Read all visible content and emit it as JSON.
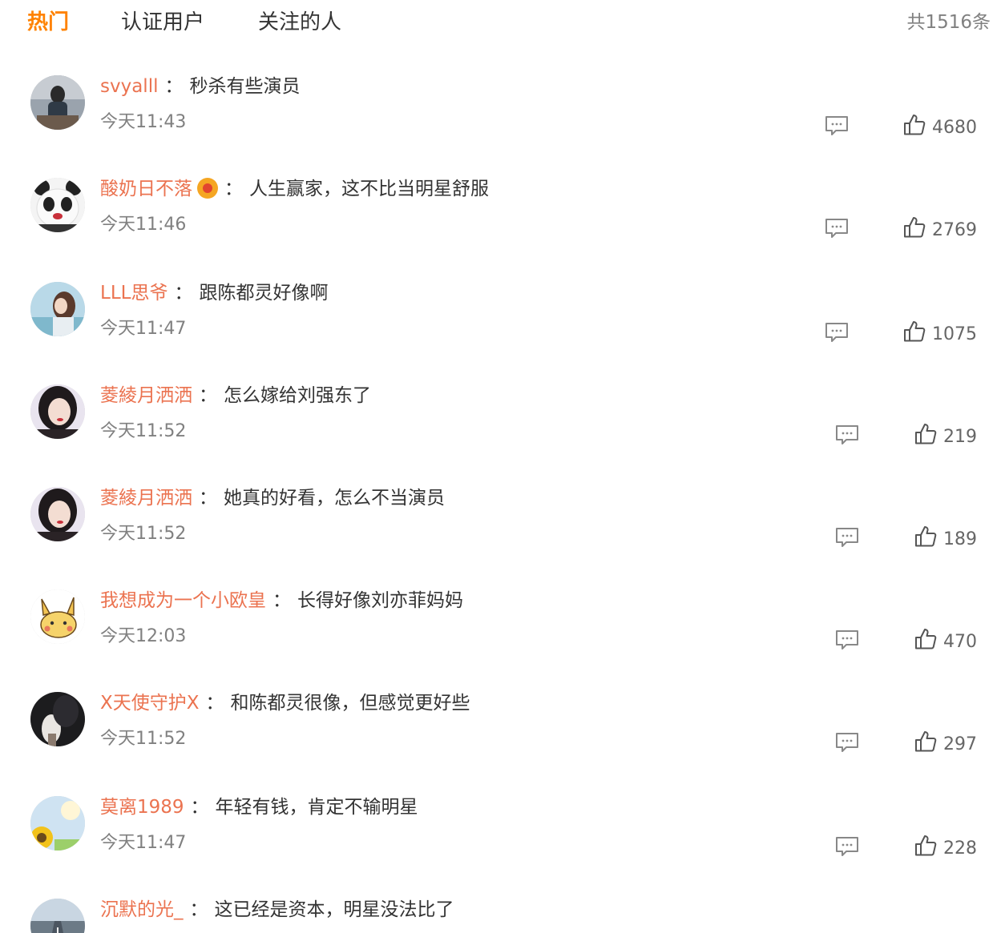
{
  "tabs": {
    "hot": "热门",
    "verified": "认证用户",
    "following": "关注的人"
  },
  "total_count": "共1516条",
  "separator": "：",
  "comments": [
    {
      "user": "svyalll",
      "text": "秒杀有些演员",
      "time": "今天11:43",
      "likes": "4680",
      "badge": false,
      "avatar": "woman-photo-avatar"
    },
    {
      "user": "酸奶日不落",
      "text": "人生赢家，这不比当明星舒服",
      "time": "今天11:46",
      "likes": "2769",
      "badge": true,
      "avatar": "panda-avatar"
    },
    {
      "user": "LLL思爷",
      "text": "跟陈都灵好像啊",
      "time": "今天11:47",
      "likes": "1075",
      "badge": false,
      "avatar": "illustrated-girl-avatar"
    },
    {
      "user": "菱綾月洒洒",
      "text": "怎么嫁给刘强东了",
      "time": "今天11:52",
      "likes": "219",
      "badge": false,
      "avatar": "girl-portrait-avatar"
    },
    {
      "user": "菱綾月洒洒",
      "text": "她真的好看，怎么不当演员",
      "time": "今天11:52",
      "likes": "189",
      "badge": false,
      "avatar": "girl-portrait-avatar"
    },
    {
      "user": "我想成为一个小欧皇",
      "text": "长得好像刘亦菲妈妈",
      "time": "今天12:03",
      "likes": "470",
      "badge": false,
      "avatar": "pikachu-avatar"
    },
    {
      "user": "X天使守护X",
      "text": "和陈都灵很像，但感觉更好些",
      "time": "今天11:52",
      "likes": "297",
      "badge": false,
      "avatar": "dark-photo-avatar"
    },
    {
      "user": "莫离1989",
      "text": "年轻有钱，肯定不输明星",
      "time": "今天11:47",
      "likes": "228",
      "badge": false,
      "avatar": "sunflower-avatar"
    },
    {
      "user": "沉默的光_",
      "text": "这已经是资本，明星没法比了",
      "time": "",
      "likes": "",
      "badge": false,
      "avatar": "road-photo-avatar"
    }
  ],
  "colors": {
    "accent": "#ff8200",
    "username": "#eb7350",
    "text": "#333333",
    "muted": "#808080"
  }
}
